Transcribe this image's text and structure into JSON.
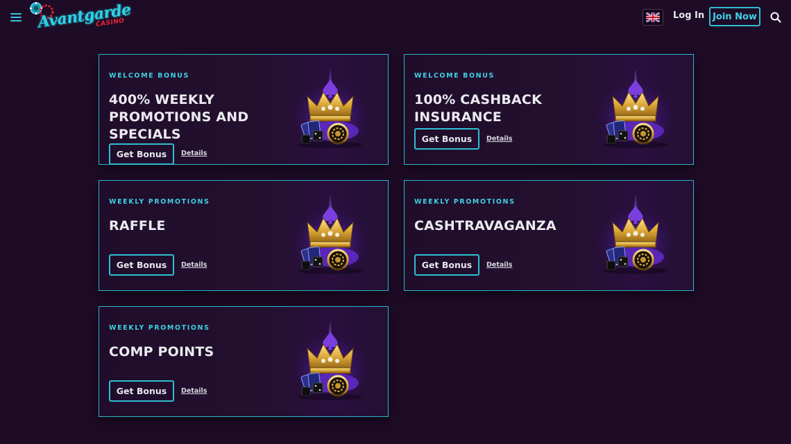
{
  "header": {
    "logo_text": "Avantgarde",
    "logo_sub": "CASINO",
    "login_label": "Log In",
    "join_label": "Join Now",
    "icons": {
      "menu": "hamburger-menu-icon",
      "flag": "uk-flag-icon",
      "search": "search-icon"
    }
  },
  "cards": [
    {
      "tag": "WELCOME BONUS",
      "title": "400% WEEKLY PROMOTIONS AND SPECIALS",
      "button": "Get Bonus",
      "details": "Details"
    },
    {
      "tag": "WELCOME BONUS",
      "title": "100% CASHBACK INSURANCE",
      "button": "Get Bonus",
      "details": "Details"
    },
    {
      "tag": "WEEKLY PROMOTIONS",
      "title": "RAFFLE",
      "button": "Get Bonus",
      "details": "Details"
    },
    {
      "tag": "WEEKLY PROMOTIONS",
      "title": "CASHTRAVAGANZA",
      "button": "Get Bonus",
      "details": "Details"
    },
    {
      "tag": "WEEKLY PROMOTIONS",
      "title": "COMP POINTS",
      "button": "Get Bonus",
      "details": "Details"
    }
  ],
  "colors": {
    "background": "#1e0b26",
    "accent": "#2fbfd3",
    "text": "#ebebef",
    "logo_red": "#e8243a"
  }
}
